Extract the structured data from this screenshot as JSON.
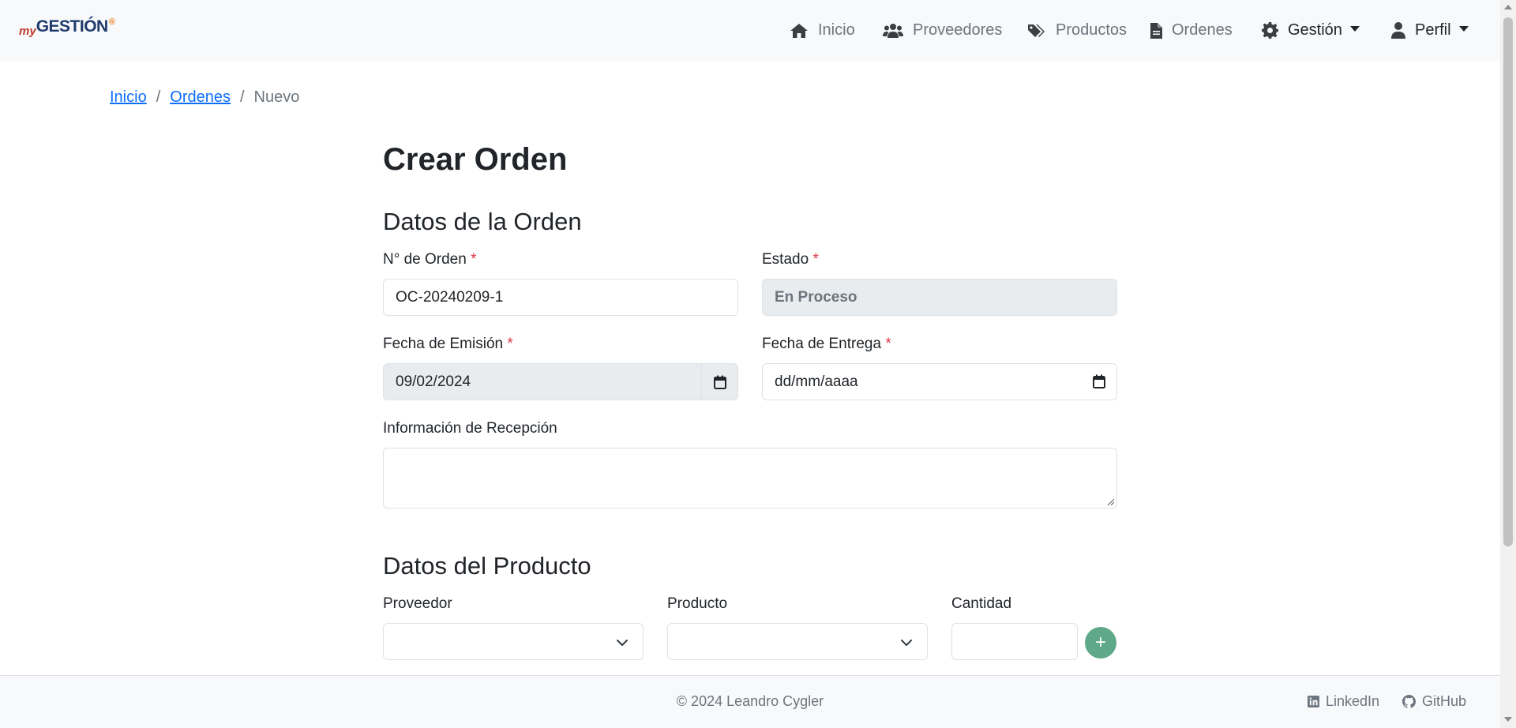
{
  "brand": {
    "prefix": "my",
    "name": "GESTIÓN",
    "mark": "®"
  },
  "nav": {
    "inicio": "Inicio",
    "proveedores": "Proveedores",
    "productos": "Productos",
    "ordenes": "Ordenes",
    "gestion": "Gestión",
    "perfil": "Perfil"
  },
  "breadcrumb": {
    "inicio": "Inicio",
    "ordenes": "Ordenes",
    "current": "Nuevo",
    "separator": "/"
  },
  "page": {
    "title": "Crear Orden"
  },
  "orden": {
    "section_title": "Datos de la Orden",
    "numero_label": "N° de Orden",
    "numero_value": "OC-20240209-1",
    "estado_label": "Estado",
    "estado_value": "En Proceso",
    "fecha_emision_label": "Fecha de Emisión",
    "fecha_emision_value": "09/02/2024",
    "fecha_entrega_label": "Fecha de Entrega",
    "fecha_entrega_placeholder": "dd/mm/aaaa",
    "recepcion_label": "Información de Recepción",
    "required_mark": "*"
  },
  "producto": {
    "section_title": "Datos del Producto",
    "proveedor_label": "Proveedor",
    "producto_label": "Producto",
    "cantidad_label": "Cantidad",
    "add_label": "+"
  },
  "footer": {
    "copyright": "© 2024 Leandro Cygler",
    "linkedin": "LinkedIn",
    "github": "GitHub"
  },
  "colors": {
    "primary_link": "#0d6efd",
    "required": "#dc3545",
    "add_button": "#5fa888",
    "navbar_bg": "#f8f9fa"
  },
  "icons": [
    "home-icon",
    "users-icon",
    "tags-icon",
    "file-icon",
    "gear-icon",
    "user-icon",
    "calendar-icon",
    "chevron-down-icon",
    "linkedin-icon",
    "github-icon"
  ]
}
